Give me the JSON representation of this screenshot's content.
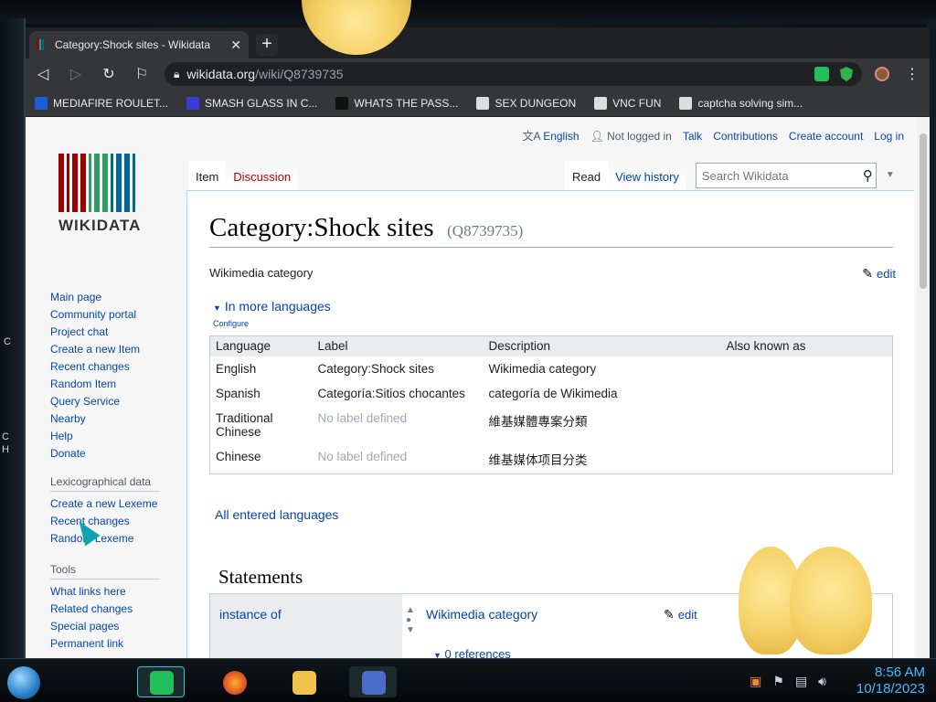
{
  "desktop": {
    "left_text_1": "C",
    "left_text_2": "C",
    "left_text_3": "H"
  },
  "browser": {
    "tab_title": "Category:Shock sites - Wikidata",
    "tab_close": "✕",
    "new_tab": "+",
    "url_host": "wikidata.org",
    "url_path": "/wiki/Q8739735",
    "bookmarks": [
      {
        "label": "MEDIAFIRE ROULET...",
        "color": "#1a5fd8"
      },
      {
        "label": "SMASH GLASS IN C...",
        "color": "#3b3bd8"
      },
      {
        "label": "WHATS THE PASS...",
        "color": "#111111"
      },
      {
        "label": "SEX DUNGEON",
        "color": "#dddddd"
      },
      {
        "label": "VNC FUN",
        "color": "#dddddd"
      },
      {
        "label": "captcha solving sim...",
        "color": "#dddddd"
      }
    ]
  },
  "wiki": {
    "logo_text": "WIKIDATA",
    "personal": {
      "language": "English",
      "not_logged_in": "Not logged in",
      "talk": "Talk",
      "contributions": "Contributions",
      "create_account": "Create account",
      "login": "Log in"
    },
    "tabs": {
      "item": "Item",
      "discussion": "Discussion",
      "read": "Read",
      "view_history": "View history"
    },
    "search_placeholder": "Search Wikidata",
    "sidebar": {
      "main": [
        "Main page",
        "Community portal",
        "Project chat",
        "Create a new Item",
        "Recent changes",
        "Random Item",
        "Query Service",
        "Nearby",
        "Help",
        "Donate"
      ],
      "lexico_heading": "Lexicographical data",
      "lexico": [
        "Create a new Lexeme",
        "Recent changes",
        "Random Lexeme"
      ],
      "tools_heading": "Tools",
      "tools": [
        "What links here",
        "Related changes",
        "Special pages",
        "Permanent link"
      ]
    },
    "title": "Category:Shock sites",
    "qid": "(Q8739735)",
    "description": "Wikimedia category",
    "edit": "edit",
    "more_languages": "In more languages",
    "configure": "Configure",
    "lang_table": {
      "headers": [
        "Language",
        "Label",
        "Description",
        "Also known as"
      ],
      "rows": [
        {
          "language": "English",
          "label": "Category:Shock sites",
          "description": "Wikimedia category",
          "aka": ""
        },
        {
          "language": "Spanish",
          "label": "Categoría:Sitios chocantes",
          "description": "categoría de Wikimedia",
          "aka": ""
        },
        {
          "language": "Traditional Chinese",
          "label": "No label defined",
          "description": "維基媒體專案分類",
          "aka": ""
        },
        {
          "language": "Chinese",
          "label": "No label defined",
          "description": "维基媒体项目分类",
          "aka": ""
        }
      ]
    },
    "all_languages": "All entered languages",
    "statements_heading": "Statements",
    "statement": {
      "property": "instance of",
      "value": "Wikimedia category",
      "edit": "edit",
      "references": "0 references"
    }
  },
  "taskbar": {
    "clock_time": "8:56 AM",
    "clock_date": "10/18/2023"
  }
}
